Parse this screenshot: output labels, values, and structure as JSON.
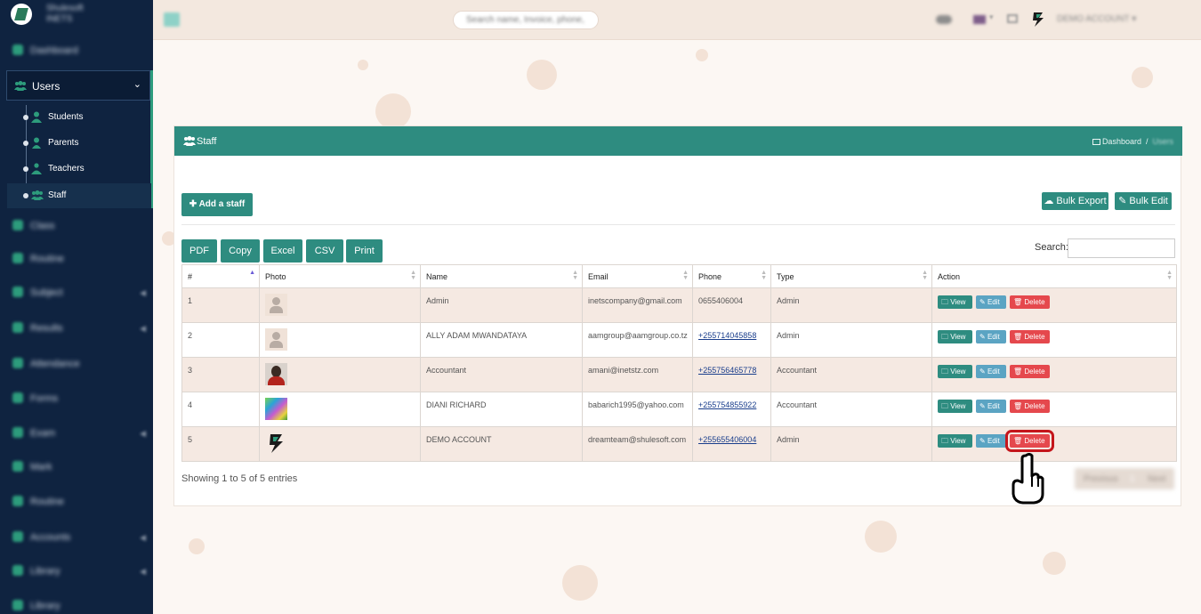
{
  "sidebar": {
    "brand_title": "Shulesoft",
    "brand_subtitle": "INETS",
    "items_top": [
      {
        "label": "Dashboard",
        "icon": "dashboard-icon"
      }
    ],
    "users": {
      "label": "Users",
      "icon": "users-icon",
      "chevron": "⌄"
    },
    "sub_items": [
      {
        "label": "Students",
        "icon": "student-icon",
        "active": false
      },
      {
        "label": "Parents",
        "icon": "parent-icon",
        "active": false
      },
      {
        "label": "Teachers",
        "icon": "teacher-icon",
        "active": false
      },
      {
        "label": "Staff",
        "icon": "staff-icon",
        "active": true
      }
    ],
    "items_bottom": [
      {
        "label": "Class",
        "icon": "class-icon",
        "chevron": ""
      },
      {
        "label": "Routine",
        "icon": "routine-icon",
        "chevron": ""
      },
      {
        "label": "Subject",
        "icon": "subject-icon",
        "chevron": "◀"
      },
      {
        "label": "Results",
        "icon": "results-icon",
        "chevron": "◀"
      },
      {
        "label": "Attendance",
        "icon": "attendance-icon",
        "chevron": ""
      },
      {
        "label": "Forms",
        "icon": "forms-icon",
        "chevron": ""
      },
      {
        "label": "Exam",
        "icon": "exam-icon",
        "chevron": "◀"
      },
      {
        "label": "Mark",
        "icon": "mark-icon",
        "chevron": ""
      },
      {
        "label": "Routine",
        "icon": "routine2-icon",
        "chevron": ""
      },
      {
        "label": "Accounts",
        "icon": "accounts-icon",
        "chevron": "◀"
      },
      {
        "label": "Library",
        "icon": "library-icon",
        "chevron": "◀"
      },
      {
        "label": "Library",
        "icon": "library2-icon",
        "chevron": ""
      }
    ]
  },
  "topbar": {
    "search_placeholder": "Search name, Invoice, phone,",
    "account_name": "DEMO ACCOUNT"
  },
  "panel": {
    "title": "Staff",
    "breadcrumb_home": "Dashboard",
    "breadcrumb_sep": "/",
    "breadcrumb_current": "Users",
    "add_button": "Add a staff",
    "bulk_export": "Bulk Export",
    "bulk_edit": "Bulk Edit",
    "export_buttons": [
      "PDF",
      "Copy",
      "Excel",
      "CSV",
      "Print"
    ],
    "search_label": "Search:",
    "columns": [
      "#",
      "Photo",
      "Name",
      "Email",
      "Phone",
      "Type",
      "Action"
    ],
    "rows": [
      {
        "num": "1",
        "photo": "placeholder",
        "name": "Admin",
        "email": "inetscompany@gmail.com",
        "phone": "0655406004",
        "phone_link": false,
        "type": "Admin"
      },
      {
        "num": "2",
        "photo": "placeholder",
        "name": "ALLY ADAM MWANDATAYA",
        "email": "aamgroup@aamgroup.co.tz",
        "phone": "+255714045858",
        "phone_link": true,
        "type": "Admin"
      },
      {
        "num": "3",
        "photo": "person",
        "name": "Accountant",
        "email": "amani@inetstz.com",
        "phone": "+255756465778",
        "phone_link": true,
        "type": "Accountant"
      },
      {
        "num": "4",
        "photo": "art",
        "name": "DIANI RICHARD",
        "email": "babarich1995@yahoo.com",
        "phone": "+255754855922",
        "phone_link": true,
        "type": "Accountant"
      },
      {
        "num": "5",
        "photo": "logo",
        "name": "DEMO ACCOUNT",
        "email": "dreamteam@shulesoft.com",
        "phone": "+255655406004",
        "phone_link": true,
        "type": "Admin"
      }
    ],
    "action_labels": {
      "view": "View",
      "edit": "Edit",
      "delete": "Delete"
    },
    "info": "Showing 1 to 5 of 5 entries",
    "pager": {
      "previous": "Previous",
      "page": "1",
      "next": "Next"
    }
  },
  "colors": {
    "sidebar": "#0f2340",
    "accent": "#2e8c80",
    "delete": "#e5484d",
    "edit": "#5ba4c3",
    "highlight": "#c4161c"
  }
}
